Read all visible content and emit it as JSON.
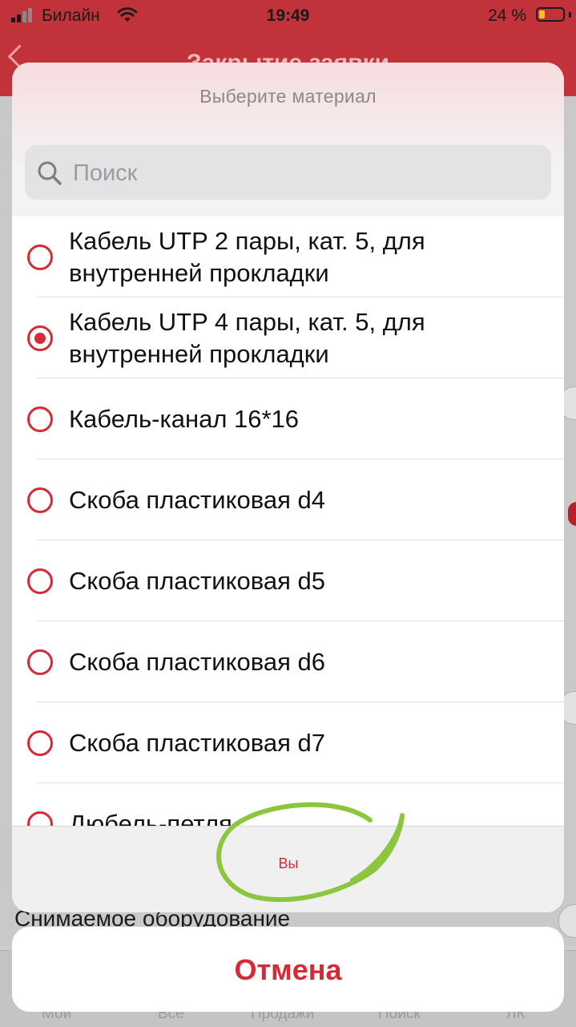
{
  "status_bar": {
    "carrier": "Билайн",
    "time": "19:49",
    "battery": "24 %",
    "battery_level": 0.24
  },
  "background": {
    "title": "Закрытие заявки",
    "removable_equipment": "Снимаемое оборудование",
    "tabs": [
      "Мои",
      "Все",
      "Продажи",
      "Поиск",
      "ЛК"
    ]
  },
  "sheet": {
    "title": "Выберите материал",
    "search_placeholder": "Поиск",
    "items": [
      {
        "label": "Кабель UTP 2 пары, кат. 5, для внутренней прокладки",
        "selected": false
      },
      {
        "label": "Кабель UTP 4 пары, кат. 5, для внутренней прокладки",
        "selected": true
      },
      {
        "label": "Кабель-канал 16*16",
        "selected": false
      },
      {
        "label": "Скоба пластиковая d4",
        "selected": false
      },
      {
        "label": "Скоба пластиковая d5",
        "selected": false
      },
      {
        "label": "Скоба пластиковая d6",
        "selected": false
      },
      {
        "label": "Скоба пластиковая d7",
        "selected": false
      },
      {
        "label": "Дюбель-петля",
        "selected": false
      }
    ],
    "select_label": "Вы"
  },
  "cancel_label": "Отмена",
  "colors": {
    "accent": "#d62b36",
    "header": "#c2323b",
    "annotation": "#8cc63f"
  }
}
